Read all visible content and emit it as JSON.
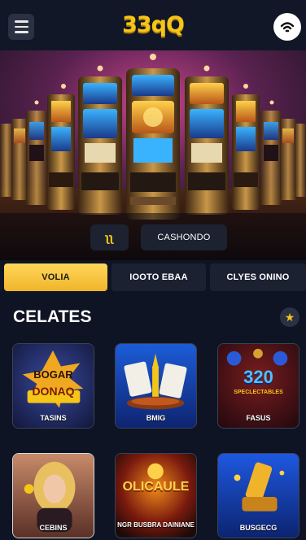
{
  "header": {
    "logo": "33qQ",
    "menu_icon": "hamburger-menu-icon",
    "profile_icon": "wifi-signal-icon"
  },
  "hero": {
    "button_a_label": "ʅʅ",
    "button_b_label": "CASHONDO"
  },
  "tabs": [
    {
      "label": "VOLIA",
      "active": true
    },
    {
      "label": "IOOTO EBAA",
      "active": false
    },
    {
      "label": "CLYES ONINO",
      "active": false
    }
  ],
  "section": {
    "title": "CELATES",
    "star_icon": "star-icon"
  },
  "games": [
    {
      "art_line1": "BOGAR",
      "art_line2": "DONAQ",
      "label": "TASINS"
    },
    {
      "art_line1": "",
      "art_line2": "",
      "label": "BMIG"
    },
    {
      "art_line1": "320",
      "art_line2": "SPECLECTABLES",
      "label": "FASUS"
    },
    {
      "art_line1": "",
      "art_line2": "",
      "label": "CEBINS"
    },
    {
      "art_line1": "OLICAULE",
      "art_line2": "",
      "label": "NGR BUSBRA DAINIANE"
    },
    {
      "art_line1": "",
      "art_line2": "",
      "label": "BUSGECG"
    }
  ],
  "colors": {
    "background": "#0f1424",
    "accent_gold": "#f5c518",
    "tab_inactive": "#1b2130"
  }
}
